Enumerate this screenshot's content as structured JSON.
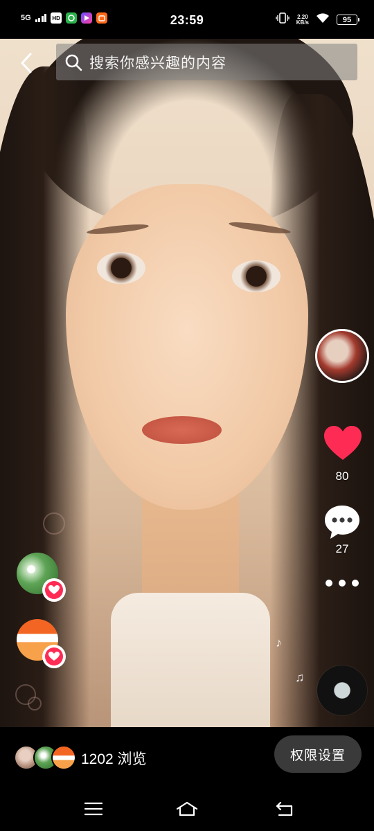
{
  "status_bar": {
    "network": "5G",
    "hd_label": "HD",
    "time": "23:59",
    "speed_value": "2.20",
    "speed_unit": "KB/s",
    "battery": "95"
  },
  "search": {
    "placeholder": "搜索你感兴趣的内容"
  },
  "actions": {
    "like_count": "80",
    "comment_count": "27"
  },
  "bottom_bar": {
    "views_text": "1202 浏览",
    "permission_button": "权限设置"
  },
  "icons": {
    "back": "back-icon",
    "search": "search-icon",
    "like": "heart-icon",
    "comment": "comment-icon",
    "more": "more-icon",
    "music": "music-note-icon",
    "nav_menu": "menu-icon",
    "nav_home": "home-icon",
    "nav_back": "nav-back-icon"
  },
  "colors": {
    "like": "#fe2c55",
    "background": "#000000",
    "button_bg": "#3a3a3a"
  }
}
